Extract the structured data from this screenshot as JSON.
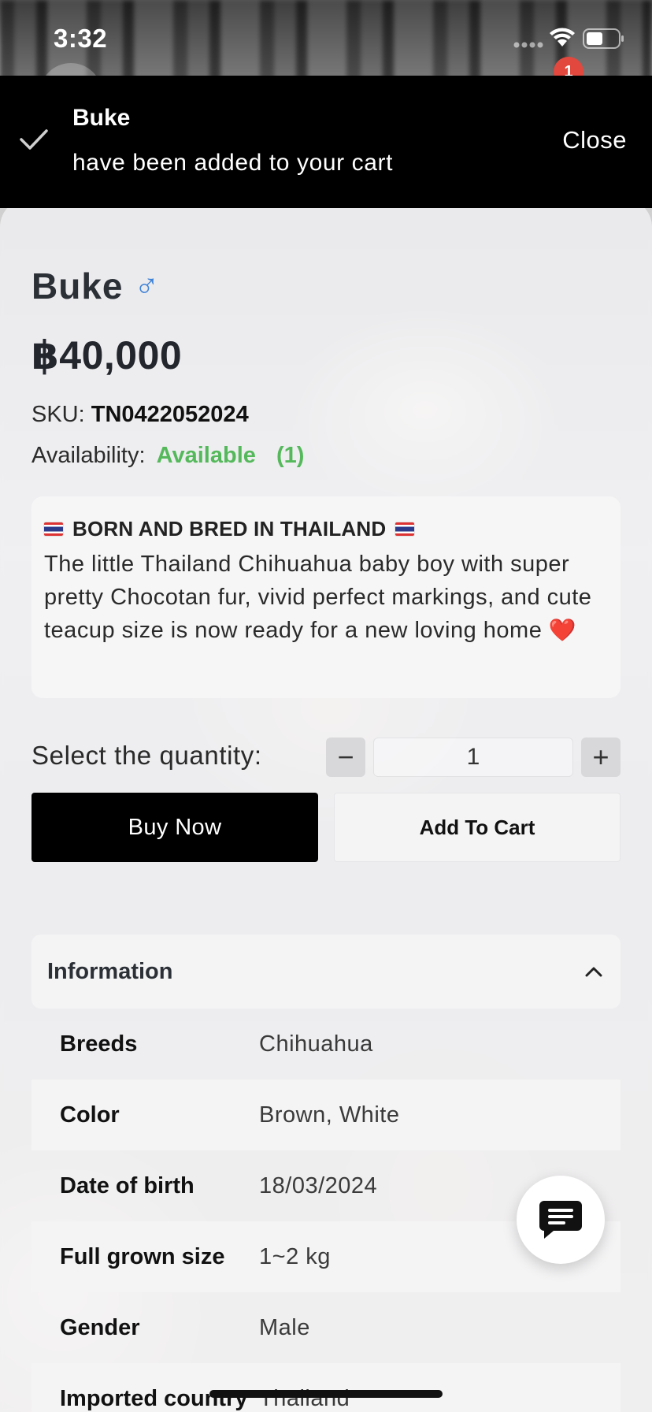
{
  "status_bar": {
    "time": "3:32"
  },
  "cart": {
    "badge_count": "1"
  },
  "toast": {
    "title": "Buke",
    "message": "have been added to your cart",
    "close_label": "Close"
  },
  "product": {
    "name": "Buke",
    "gender_symbol": "♂",
    "price": "฿40,000",
    "sku_label": "SKU:",
    "sku_value": "TN0422052024",
    "availability_label": "Availability:",
    "availability_status": "Available",
    "availability_count": "(1)",
    "description_heading": "BORN AND BRED IN THAILAND",
    "description_text": "The little Thailand Chihuahua baby boy with super pretty Chocotan fur, vivid perfect markings, and cute teacup size is now ready for a new loving home",
    "heart_glyph": "❤️"
  },
  "quantity": {
    "label": "Select the quantity:",
    "minus": "−",
    "value": "1",
    "plus": "+"
  },
  "actions": {
    "buy_now": "Buy Now",
    "add_to_cart": "Add To Cart"
  },
  "information": {
    "title": "Information",
    "rows": [
      {
        "key": "Breeds",
        "value": "Chihuahua"
      },
      {
        "key": "Color",
        "value": "Brown, White"
      },
      {
        "key": "Date of birth",
        "value": "18/03/2024"
      },
      {
        "key": "Full grown size",
        "value": "1~2 kg"
      },
      {
        "key": "Gender",
        "value": "Male"
      },
      {
        "key": "Imported country",
        "value": "Thailand"
      }
    ]
  },
  "colors": {
    "available_green": "#55b95c",
    "badge_red": "#e2483d",
    "male_blue": "#3f83d8",
    "toast_bg": "#000000"
  }
}
